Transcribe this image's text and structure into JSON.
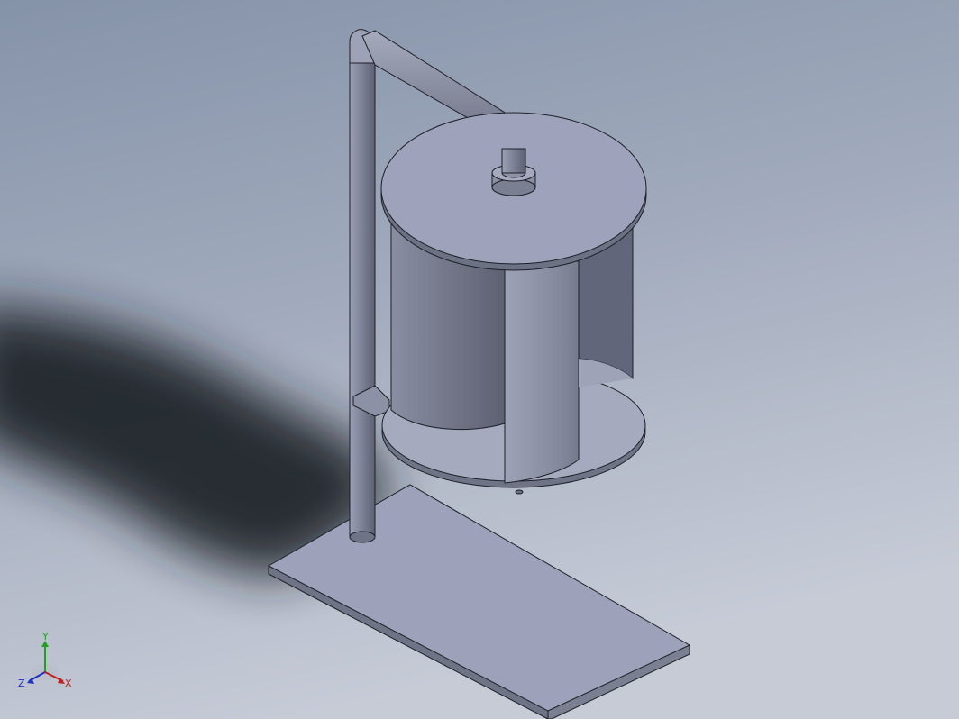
{
  "viewport": {
    "background_top": "#8a97ad",
    "background_bottom": "#c5cad6",
    "model_fill": "#9aa0b8",
    "model_dark": "#5b5f70",
    "model_light": "#b4b8cc",
    "edge_color": "#1e1f26",
    "shadow_color": "#1f2226"
  },
  "triad": {
    "x_label": "X",
    "y_label": "Y",
    "z_label": "Z",
    "x_color": "#c0201e",
    "y_color": "#20a020",
    "z_color": "#2030c0"
  }
}
